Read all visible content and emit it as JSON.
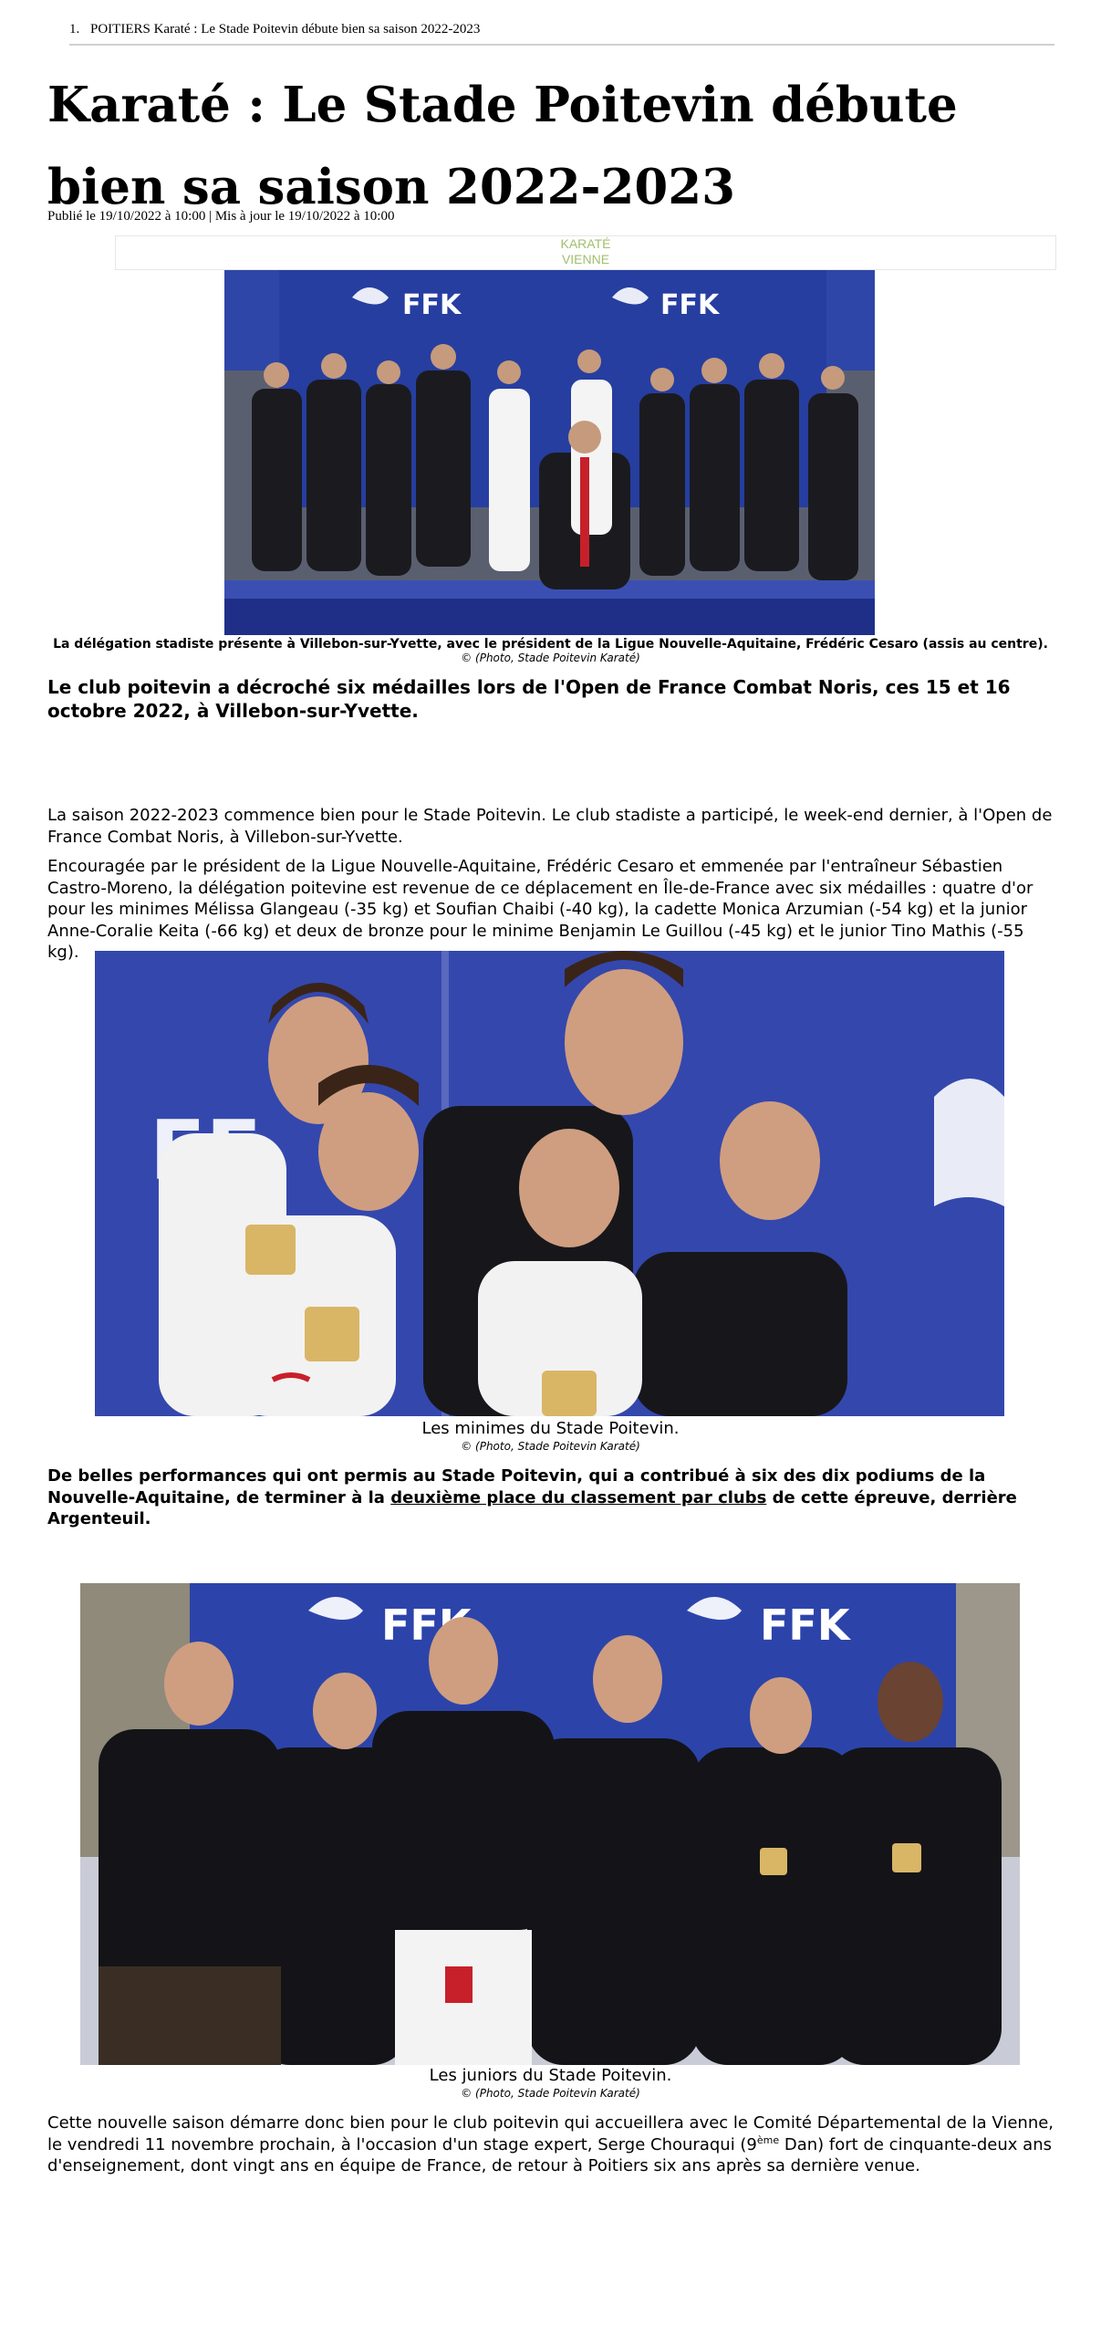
{
  "breadcrumb": {
    "number": "1.",
    "text": "POITIERS Karaté : Le Stade Poitevin débute bien sa saison 2022-2023"
  },
  "article": {
    "title": "Karaté : Le Stade Poitevin débute bien sa saison 2022-2023",
    "meta": "Publié le 19/10/2022 à 10:00 | Mis à jour le 19/10/2022 à 10:00",
    "tags": [
      "KARATÉ",
      "VIENNE"
    ],
    "photo1": {
      "banner": "FFK",
      "caption": "La délégation stadiste présente à Villebon-sur-Yvette, avec le président de la Ligue Nouvelle-Aquitaine, Frédéric Cesaro (assis au centre).",
      "credit": "© (Photo, Stade Poitevin Karaté)"
    },
    "lead": "Le club poitevin a décroché six médailles lors de l'Open de France Combat Noris, ces 15 et 16  octobre 2022, à Villebon-sur-Yvette.",
    "paragraph1": "La saison 2022-2023 commence bien pour le Stade Poitevin. Le club stadiste a participé, le week-end dernier, à l'Open de France Combat Noris, à Villebon-sur-Yvette.",
    "paragraph2": "Encouragée par le président de la Ligue Nouvelle-Aquitaine, Frédéric Cesaro et emmenée par l'entraîneur Sébastien Castro-Moreno, la délégation poitevine est revenue de ce déplacement en Île-de-France avec six médailles : quatre d'or pour les minimes Mélissa Glangeau (-35 kg) et Soufian Chaibi (-40 kg), la cadette Monica Arzumian (-54 kg) et la junior Anne-Coralie Keita (-66 kg) et deux de bronze pour le minime Benjamin Le Guillou (-45 kg) et le junior Tino Mathis (-55 kg).",
    "photo2": {
      "banner": "FF",
      "caption": "Les minimes du Stade Poitevin.",
      "credit": "© (Photo, Stade Poitevin Karaté)"
    },
    "paragraph3": {
      "before": "De belles performances qui ont permis au Stade Poitevin, qui a contribué à six des dix podiums de la Nouvelle-Aquitaine, de terminer à la ",
      "link": "deuxième place du classement par clubs",
      "after": " de cette épreuve, derrière Argenteuil."
    },
    "photo3": {
      "banner_left": "FFK",
      "banner_right": "FFK",
      "caption": "Les juniors du Stade Poitevin.",
      "credit": "© (Photo, Stade Poitevin Karaté)"
    },
    "paragraph4": {
      "before": "Cette nouvelle saison démarre donc bien pour le club poitevin qui accueillera avec le Comité Départemental de la Vienne, le vendredi 11 novembre prochain, à l'occasion d'un stage expert, Serge Chouraqui (9",
      "sup": "ème",
      "after": " Dan) fort de cinquante-deux ans d'enseignement, dont vingt ans en équipe de France, de retour à Poitiers six ans après sa dernière venue."
    }
  }
}
